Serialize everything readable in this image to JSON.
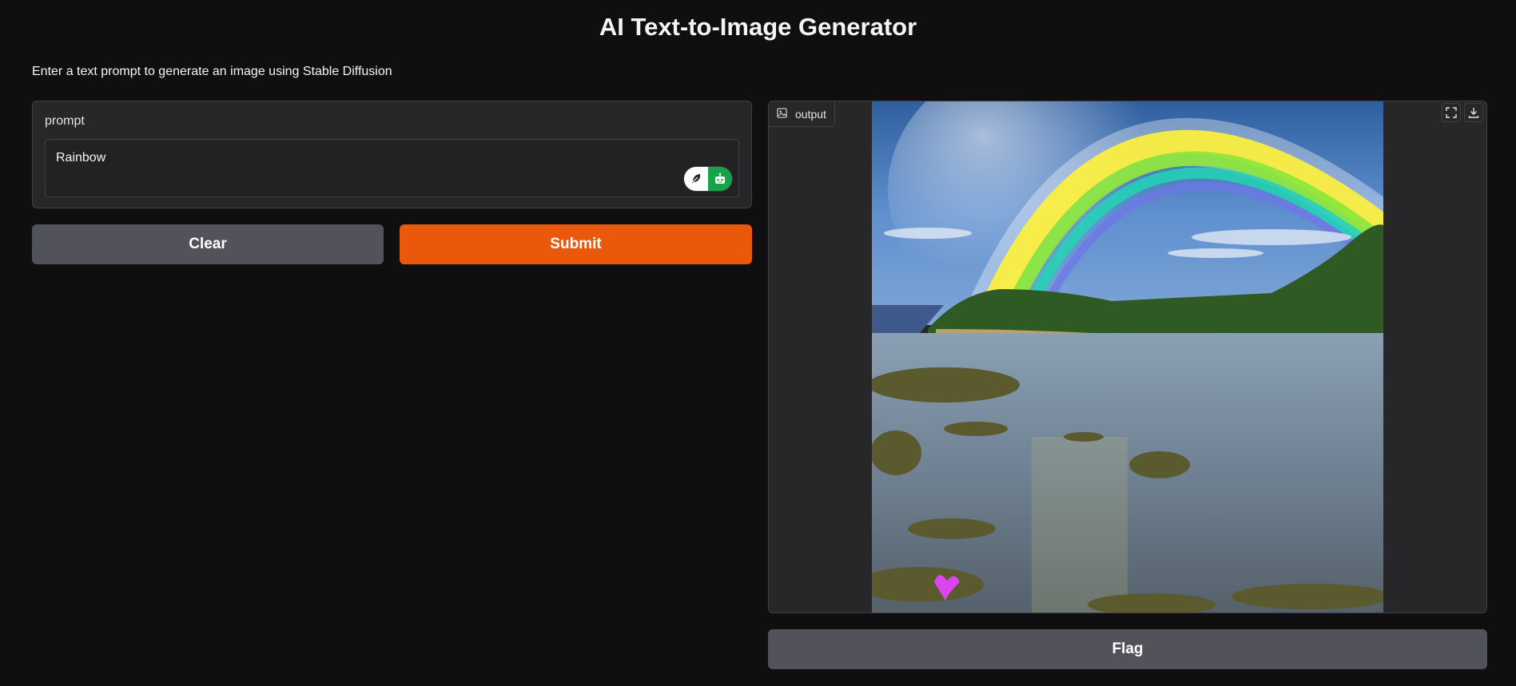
{
  "app": {
    "title": "AI Text-to-Image Generator",
    "description": "Enter a text prompt to generate an image using Stable Diffusion"
  },
  "input": {
    "label": "prompt",
    "value": "Rainbow",
    "extension_icons": [
      "feather-icon",
      "robot-icon"
    ]
  },
  "buttons": {
    "clear": "Clear",
    "submit": "Submit",
    "flag": "Flag"
  },
  "output": {
    "label": "output",
    "label_icon": "image-icon",
    "actions": [
      "fullscreen-icon",
      "download-icon"
    ]
  },
  "colors": {
    "background": "#0f0f11",
    "panel": "#27272a",
    "accent": "#ea580c",
    "secondary_button": "#52525b"
  }
}
